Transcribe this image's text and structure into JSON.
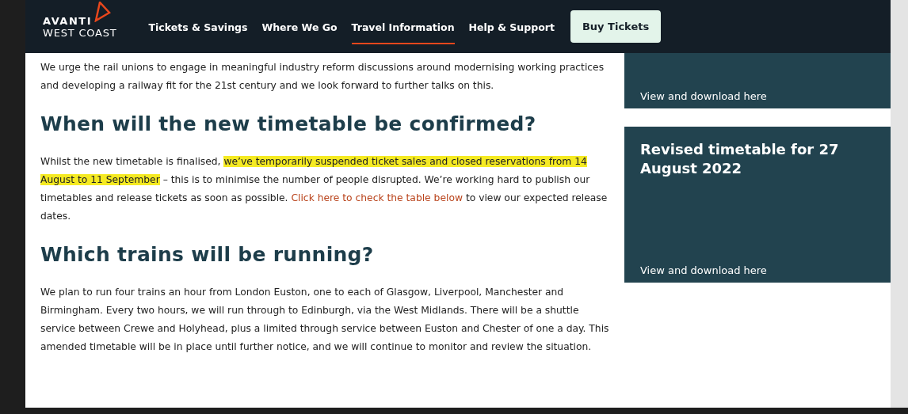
{
  "header": {
    "logo": {
      "line_1": "AVANTI",
      "line_2": "WEST COAST"
    },
    "nav": [
      {
        "label": "Tickets & Savings",
        "selected": false
      },
      {
        "label": "Where We Go",
        "selected": false
      },
      {
        "label": "Travel Information",
        "selected": true
      },
      {
        "label": "Help & Support",
        "selected": false
      }
    ],
    "cta": "Buy Tickets"
  },
  "main": [
    {
      "kind": "paragraph",
      "segments": [
        {
          "kind": "text",
          "text": "We urge the rail unions to engage in meaningful industry reform discussions around modernising working practices and developing a railway fit for the 21st century and we look forward to further talks on this."
        }
      ]
    },
    {
      "kind": "heading",
      "text": "When will the new timetable be confirmed?"
    },
    {
      "kind": "paragraph",
      "segments": [
        {
          "kind": "text",
          "text": "Whilst the new timetable is finalised, "
        },
        {
          "kind": "highlight",
          "text": "we’ve temporarily suspended ticket sales and closed reservations from 14 August to 11 September"
        },
        {
          "kind": "text",
          "text": " – this is to minimise the number of people disrupted. We’re working hard to publish our timetables and release tickets as soon as possible. "
        },
        {
          "kind": "link",
          "text": "Click here to check the table below"
        },
        {
          "kind": "text",
          "text": " to view our expected release dates."
        }
      ]
    },
    {
      "kind": "heading",
      "text": "Which trains will be running?"
    },
    {
      "kind": "paragraph",
      "segments": [
        {
          "kind": "text",
          "text": "We plan to run four trains an hour from London Euston, one to each of Glasgow, Liverpool, Manchester and Birmingham. Every two hours, we will run through to Edinburgh, via the West Midlands. There will be a shuttle service between Crewe and Holyhead, plus a limited through service between Euston and Chester of one a day. This amended timetable will be in place until further notice, and we will continue to monitor and review the situation."
        }
      ]
    }
  ],
  "sidebar": [
    {
      "link": "View and download here"
    },
    {
      "title": "Revised timetable for 27 August 2022",
      "link": "View and download here"
    }
  ]
}
